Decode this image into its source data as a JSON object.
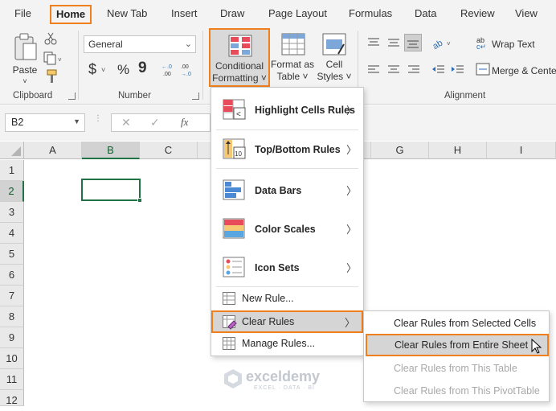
{
  "tabs": [
    "File",
    "Home",
    "New Tab",
    "Insert",
    "Draw",
    "Page Layout",
    "Formulas",
    "Data",
    "Review",
    "View"
  ],
  "ribbon": {
    "clipboard": {
      "paste": "Paste",
      "group": "Clipboard"
    },
    "number": {
      "format": "General",
      "currency": "$",
      "percent": "%",
      "comma": "9",
      "group": "Number"
    },
    "styles": {
      "conditional_1": "Conditional",
      "conditional_2": "Formatting ˅",
      "format_table_1": "Format as",
      "format_table_2": "Table ˅",
      "cell_styles_1": "Cell",
      "cell_styles_2": "Styles ˅"
    },
    "alignment": {
      "wrap_text": "Wrap Text",
      "merge": "Merge & Cente",
      "group": "Alignment"
    }
  },
  "formula_bar": {
    "name_box": "B2",
    "fx": "fx"
  },
  "columns": [
    "A",
    "B",
    "C",
    "G",
    "H",
    "I"
  ],
  "rows": [
    "1",
    "2",
    "3",
    "4",
    "5",
    "6",
    "7",
    "8",
    "9",
    "10",
    "11",
    "12"
  ],
  "cf_menu": {
    "items": [
      "Highlight Cells Rules",
      "Top/Bottom Rules",
      "Data Bars",
      "Color Scales",
      "Icon Sets",
      "New Rule...",
      "Clear Rules",
      "Manage Rules..."
    ],
    "highlight_icon_text": "<",
    "topbottom_icon_text": "10"
  },
  "clear_submenu": {
    "items": [
      "Clear Rules from Selected Cells",
      "Clear Rules from Entire Sheet",
      "Clear Rules from This Table",
      "Clear Rules from This PivotTable"
    ]
  },
  "watermark": {
    "name": "exceldemy",
    "tagline": "EXCEL · DATA · BI"
  },
  "colors": {
    "accent_orange": "#f07f1d",
    "excel_green": "#217346"
  }
}
